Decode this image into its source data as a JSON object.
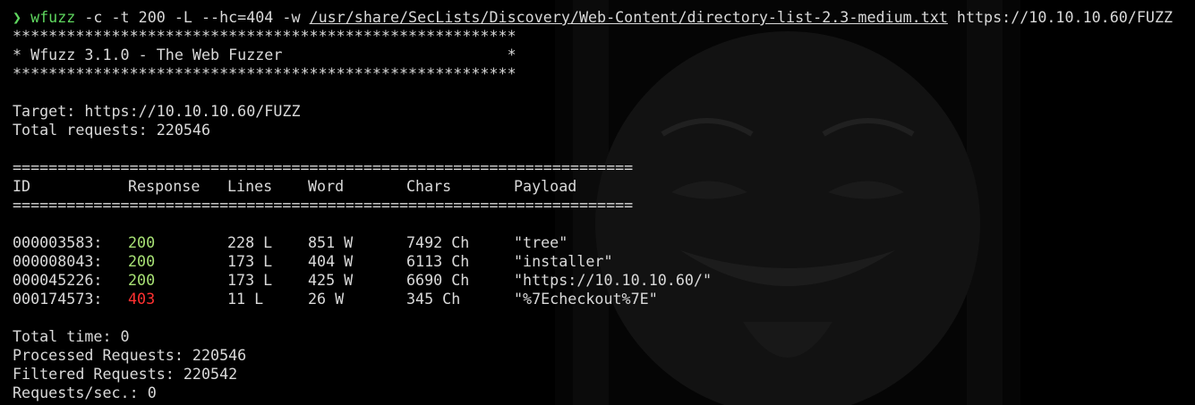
{
  "command": {
    "prompt_symbol": "❯",
    "name": "wfuzz",
    "args_before_path": " -c -t 200 -L --hc=404 -w ",
    "wordlist_path": "/usr/share/SecLists/Discovery/Web-Content/directory-list-2.3-medium.txt",
    "args_after_path": " https://10.10.10.60/FUZZ"
  },
  "banner": {
    "border": "********************************************************",
    "title_line": "* Wfuzz 3.1.0 - The Web Fuzzer                         *"
  },
  "target_line": "Target: https://10.10.10.60/FUZZ",
  "total_requests_line": "Total requests: 220546",
  "table": {
    "separator": "=====================================================================",
    "headers": {
      "id": "ID",
      "response": "Response",
      "lines": "Lines",
      "word": "Word",
      "chars": "Chars",
      "payload": "Payload"
    },
    "rows": [
      {
        "id": "000003583:",
        "response": "200",
        "lines": "228 L",
        "word": "851 W",
        "chars": "7492 Ch",
        "payload": "\"tree\""
      },
      {
        "id": "000008043:",
        "response": "200",
        "lines": "173 L",
        "word": "404 W",
        "chars": "6113 Ch",
        "payload": "\"installer\""
      },
      {
        "id": "000045226:",
        "response": "200",
        "lines": "173 L",
        "word": "425 W",
        "chars": "6690 Ch",
        "payload": "\"https://10.10.10.60/\""
      },
      {
        "id": "000174573:",
        "response": "403",
        "lines": "11 L",
        "word": "26 W",
        "chars": "345 Ch",
        "payload": "\"%7Echeckout%7E\""
      }
    ]
  },
  "summary": {
    "total_time": "Total time: 0",
    "processed": "Processed Requests: 220546",
    "filtered": "Filtered Requests: 220542",
    "rate": "Requests/sec.: 0"
  },
  "colors": {
    "background": "#000000",
    "text": "#d9d9d9",
    "prompt": "#5fd75f",
    "status_ok": "#a7e074",
    "status_forbidden": "#ff3131"
  },
  "icons": {
    "background_art": "mask-wallpaper-icon"
  }
}
